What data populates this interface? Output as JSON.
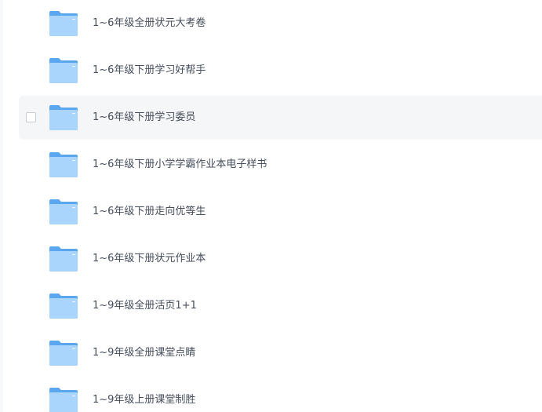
{
  "files": [
    {
      "name": "1~6年级全册状元大考卷",
      "type": "folder",
      "icon": "folder-icon"
    },
    {
      "name": "1~6年级下册学习好帮手",
      "type": "folder",
      "icon": "folder-icon"
    },
    {
      "name": "1~6年级下册学习委员",
      "type": "folder",
      "icon": "folder-icon",
      "hovered": true
    },
    {
      "name": "1~6年级下册小学学霸作业本电子样书",
      "type": "folder",
      "icon": "folder-icon"
    },
    {
      "name": "1~6年级下册走向优等生",
      "type": "folder",
      "icon": "folder-icon"
    },
    {
      "name": "1~6年级下册状元作业本",
      "type": "folder",
      "icon": "folder-icon"
    },
    {
      "name": "1~9年级全册活页1+1",
      "type": "folder",
      "icon": "folder-icon"
    },
    {
      "name": "1~9年级全册课堂点睛",
      "type": "folder",
      "icon": "folder-icon"
    },
    {
      "name": "1~9年级上册课堂制胜",
      "type": "folder",
      "icon": "folder-icon"
    }
  ],
  "colors": {
    "folder_back": "#5aa6ef",
    "folder_front": "#a9d4fb",
    "hover_bg": "#f5f6f7",
    "text": "#454d5a"
  }
}
